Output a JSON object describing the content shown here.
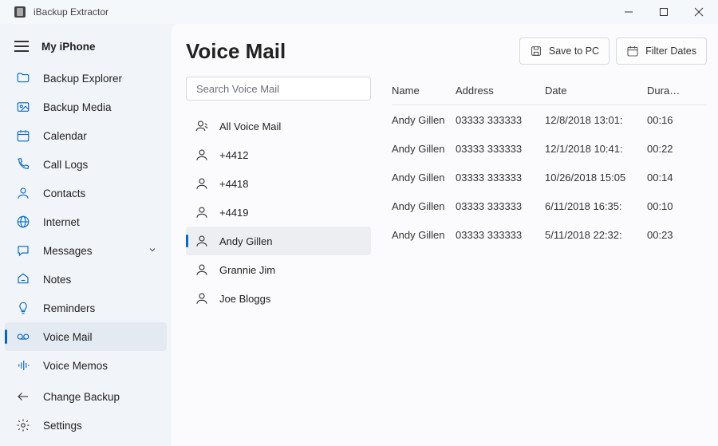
{
  "app": {
    "title": "iBackup Extractor"
  },
  "sidebar": {
    "header": "My iPhone",
    "items": [
      "Backup Explorer",
      "Backup Media",
      "Calendar",
      "Call Logs",
      "Contacts",
      "Internet",
      "Messages",
      "Notes",
      "Reminders",
      "Voice Mail",
      "Voice Memos"
    ],
    "selected_index": 9,
    "footer": {
      "change_backup": "Change Backup",
      "settings": "Settings"
    }
  },
  "page": {
    "title": "Voice Mail",
    "actions": {
      "save": "Save to PC",
      "filter": "Filter Dates"
    },
    "search_placeholder": "Search Voice Mail"
  },
  "contacts": {
    "items": [
      "All Voice Mail",
      "+4412",
      "+4418",
      "+4419",
      "Andy Gillen",
      "Grannie Jim",
      "Joe Bloggs"
    ],
    "selected_index": 4
  },
  "table": {
    "headers": {
      "name": "Name",
      "address": "Address",
      "date": "Date",
      "duration": "Duration"
    },
    "rows": [
      {
        "name": "Andy Gillen",
        "address": "03333 333333",
        "date": "12/8/2018 13:01:",
        "duration": "00:16"
      },
      {
        "name": "Andy Gillen",
        "address": "03333 333333",
        "date": "12/1/2018 10:41:",
        "duration": "00:22"
      },
      {
        "name": "Andy Gillen",
        "address": "03333 333333",
        "date": "10/26/2018 15:05",
        "duration": "00:14"
      },
      {
        "name": "Andy Gillen",
        "address": "03333 333333",
        "date": "6/11/2018 16:35:",
        "duration": "00:10"
      },
      {
        "name": "Andy Gillen",
        "address": "03333 333333",
        "date": "5/11/2018 22:32:",
        "duration": "00:23"
      }
    ]
  }
}
